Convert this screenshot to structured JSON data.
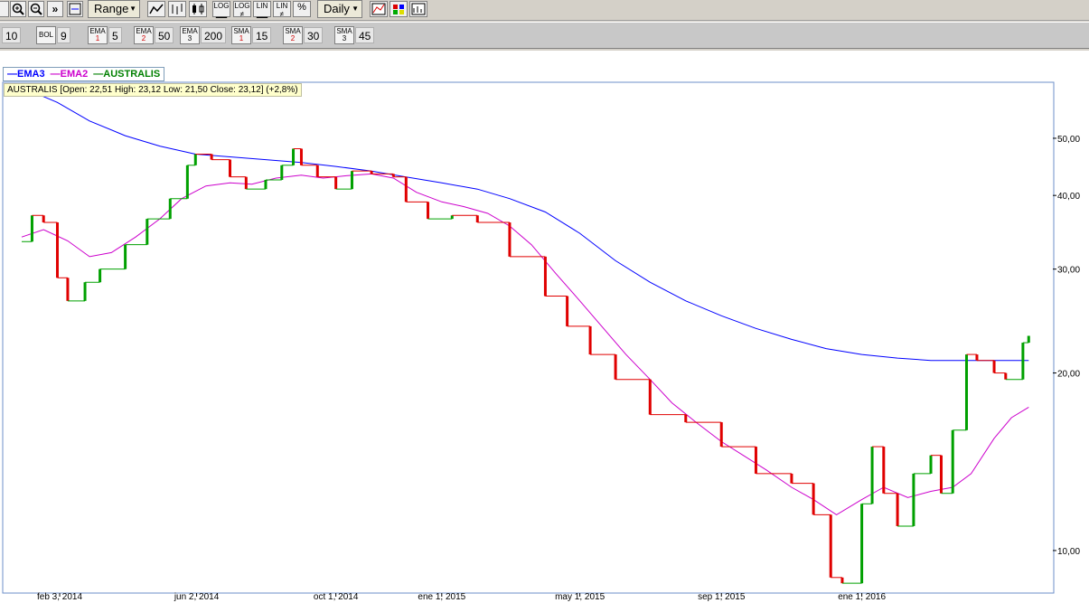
{
  "toolbar": {
    "range_label": "Range",
    "period_label": "Daily",
    "log_label": "LOG",
    "lin_label": "LIN",
    "percent_label": "%"
  },
  "indicators": [
    {
      "name": "",
      "value": "10"
    },
    {
      "name": "BOL",
      "value": "9"
    },
    {
      "name": "EMA",
      "index": "1",
      "value": "5"
    },
    {
      "name": "EMA",
      "index": "2",
      "value": "50"
    },
    {
      "name": "EMA",
      "index": "3",
      "value": "200"
    },
    {
      "name": "SMA",
      "index": "1",
      "value": "15"
    },
    {
      "name": "SMA",
      "index": "2",
      "value": "30"
    },
    {
      "name": "SMA",
      "index": "3",
      "value": "45"
    }
  ],
  "legend": {
    "ema3": "EMA3",
    "ema2": "EMA2",
    "series": "AUSTRALIS"
  },
  "info_text": "AUSTRALIS [Open: 22,51  High: 23,12  Low: 21,50  Close: 23,12] (+2,8%)",
  "colors": {
    "up": "#00a000",
    "down": "#e00000",
    "ema3": "#0000ff",
    "ema2": "#cc00cc",
    "background": "#ffffff",
    "panel": "#d4d0c8"
  },
  "chart_data": {
    "type": "line",
    "title": "AUSTRALIS",
    "scale": "log",
    "xlabel": "",
    "ylabel": "",
    "ylim": [
      8.5,
      62
    ],
    "x_tick_labels": [
      "feb 3, 2014",
      "jun 2, 2014",
      "oct 1, 2014",
      "ene 1, 2015",
      "may 1, 2015",
      "sep 1, 2015",
      "ene 1, 2016"
    ],
    "y_tick_labels": [
      "10,00",
      "20,00",
      "30,00",
      "40,00",
      "50,00"
    ],
    "y_ticks": [
      10,
      20,
      30,
      40,
      50
    ],
    "x_range": [
      "2014-01-01",
      "2016-06-15"
    ],
    "legend_position": "top-left",
    "price": [
      [
        "2014-01-01",
        33.4
      ],
      [
        "2014-01-10",
        37.0
      ],
      [
        "2014-01-20",
        36.0
      ],
      [
        "2014-02-01",
        29.0
      ],
      [
        "2014-02-10",
        26.5
      ],
      [
        "2014-02-25",
        28.5
      ],
      [
        "2014-03-10",
        30.0
      ],
      [
        "2014-04-01",
        33.0
      ],
      [
        "2014-04-20",
        36.5
      ],
      [
        "2014-05-10",
        39.5
      ],
      [
        "2014-05-25",
        45.0
      ],
      [
        "2014-06-01",
        47.0
      ],
      [
        "2014-06-15",
        46.0
      ],
      [
        "2014-07-01",
        43.0
      ],
      [
        "2014-07-15",
        41.0
      ],
      [
        "2014-08-01",
        42.5
      ],
      [
        "2014-08-15",
        45.0
      ],
      [
        "2014-08-25",
        48.0
      ],
      [
        "2014-09-01",
        45.0
      ],
      [
        "2014-09-15",
        43.0
      ],
      [
        "2014-10-01",
        41.0
      ],
      [
        "2014-10-15",
        44.0
      ],
      [
        "2014-11-01",
        43.5
      ],
      [
        "2014-11-20",
        43.0
      ],
      [
        "2014-12-01",
        39.0
      ],
      [
        "2014-12-20",
        36.5
      ],
      [
        "2015-01-10",
        37.0
      ],
      [
        "2015-02-01",
        36.0
      ],
      [
        "2015-03-01",
        31.5
      ],
      [
        "2015-04-01",
        27.0
      ],
      [
        "2015-04-20",
        24.0
      ],
      [
        "2015-05-10",
        21.5
      ],
      [
        "2015-06-01",
        19.5
      ],
      [
        "2015-07-01",
        17.0
      ],
      [
        "2015-08-01",
        16.5
      ],
      [
        "2015-09-01",
        15.0
      ],
      [
        "2015-10-01",
        13.5
      ],
      [
        "2015-11-01",
        13.0
      ],
      [
        "2015-11-20",
        11.5
      ],
      [
        "2015-12-05",
        9.0
      ],
      [
        "2015-12-15",
        8.8
      ],
      [
        "2016-01-01",
        12.0
      ],
      [
        "2016-01-10",
        15.0
      ],
      [
        "2016-01-20",
        12.5
      ],
      [
        "2016-02-01",
        11.0
      ],
      [
        "2016-02-15",
        13.5
      ],
      [
        "2016-03-01",
        14.5
      ],
      [
        "2016-03-10",
        12.5
      ],
      [
        "2016-03-20",
        16.0
      ],
      [
        "2016-04-01",
        21.5
      ],
      [
        "2016-04-10",
        21.0
      ],
      [
        "2016-04-25",
        20.0
      ],
      [
        "2016-05-05",
        19.5
      ],
      [
        "2016-05-20",
        22.51
      ],
      [
        "2016-05-25",
        23.12
      ]
    ],
    "series": [
      {
        "name": "EMA3",
        "color": "#0000ff",
        "values": [
          [
            "2014-01-01",
            61.0
          ],
          [
            "2014-02-01",
            57.5
          ],
          [
            "2014-03-01",
            53.5
          ],
          [
            "2014-04-01",
            50.5
          ],
          [
            "2014-05-01",
            48.5
          ],
          [
            "2014-06-01",
            47.0
          ],
          [
            "2014-07-01",
            46.5
          ],
          [
            "2014-08-01",
            46.0
          ],
          [
            "2014-09-01",
            45.5
          ],
          [
            "2014-10-01",
            44.8
          ],
          [
            "2014-11-01",
            44.0
          ],
          [
            "2014-12-01",
            43.0
          ],
          [
            "2015-01-01",
            42.0
          ],
          [
            "2015-02-01",
            41.0
          ],
          [
            "2015-03-01",
            39.5
          ],
          [
            "2015-04-01",
            37.5
          ],
          [
            "2015-05-01",
            34.5
          ],
          [
            "2015-06-01",
            31.0
          ],
          [
            "2015-07-01",
            28.5
          ],
          [
            "2015-08-01",
            26.5
          ],
          [
            "2015-09-01",
            25.0
          ],
          [
            "2015-10-01",
            23.8
          ],
          [
            "2015-11-01",
            22.8
          ],
          [
            "2015-12-01",
            22.0
          ],
          [
            "2016-01-01",
            21.5
          ],
          [
            "2016-02-01",
            21.2
          ],
          [
            "2016-03-01",
            21.0
          ],
          [
            "2016-04-01",
            21.0
          ],
          [
            "2016-05-01",
            21.0
          ],
          [
            "2016-05-25",
            21.0
          ]
        ]
      },
      {
        "name": "EMA2",
        "color": "#cc00cc",
        "values": [
          [
            "2014-01-01",
            34.0
          ],
          [
            "2014-01-20",
            35.0
          ],
          [
            "2014-02-10",
            33.5
          ],
          [
            "2014-03-01",
            31.5
          ],
          [
            "2014-03-20",
            32.0
          ],
          [
            "2014-04-10",
            34.0
          ],
          [
            "2014-05-01",
            36.5
          ],
          [
            "2014-05-20",
            39.5
          ],
          [
            "2014-06-10",
            41.5
          ],
          [
            "2014-07-01",
            42.0
          ],
          [
            "2014-07-20",
            41.8
          ],
          [
            "2014-08-10",
            42.8
          ],
          [
            "2014-09-01",
            43.3
          ],
          [
            "2014-09-20",
            42.8
          ],
          [
            "2014-10-10",
            43.2
          ],
          [
            "2014-11-01",
            43.5
          ],
          [
            "2014-11-20",
            42.8
          ],
          [
            "2014-12-10",
            40.5
          ],
          [
            "2015-01-01",
            39.0
          ],
          [
            "2015-01-20",
            38.3
          ],
          [
            "2015-02-10",
            37.3
          ],
          [
            "2015-03-01",
            35.5
          ],
          [
            "2015-03-20",
            33.0
          ],
          [
            "2015-04-10",
            29.5
          ],
          [
            "2015-05-01",
            26.5
          ],
          [
            "2015-05-20",
            24.0
          ],
          [
            "2015-06-10",
            21.5
          ],
          [
            "2015-07-01",
            19.5
          ],
          [
            "2015-07-20",
            17.8
          ],
          [
            "2015-08-10",
            16.5
          ],
          [
            "2015-09-01",
            15.3
          ],
          [
            "2015-09-20",
            14.5
          ],
          [
            "2015-10-10",
            13.7
          ],
          [
            "2015-11-01",
            12.8
          ],
          [
            "2015-11-20",
            12.2
          ],
          [
            "2015-12-10",
            11.5
          ],
          [
            "2016-01-01",
            12.2
          ],
          [
            "2016-01-20",
            12.8
          ],
          [
            "2016-02-10",
            12.3
          ],
          [
            "2016-03-01",
            12.6
          ],
          [
            "2016-03-20",
            12.8
          ],
          [
            "2016-04-05",
            13.5
          ],
          [
            "2016-04-25",
            15.5
          ],
          [
            "2016-05-10",
            16.8
          ],
          [
            "2016-05-25",
            17.5
          ]
        ]
      }
    ]
  }
}
